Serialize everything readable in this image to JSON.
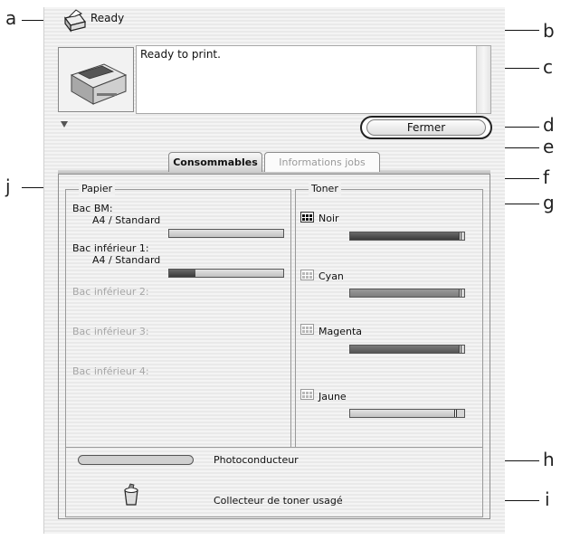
{
  "status": {
    "title": "Ready",
    "message": "Ready to print."
  },
  "buttons": {
    "close": "Fermer"
  },
  "tabs": [
    {
      "label": "Consommables",
      "active": true
    },
    {
      "label": "Informations jobs",
      "active": false
    }
  ],
  "paper": {
    "title": "Papier",
    "trays": [
      {
        "name": "Bac BM:",
        "size": "A4 / Standard",
        "level": 0.0,
        "enabled": true
      },
      {
        "name": "Bac inférieur 1:",
        "size": "A4 / Standard",
        "level": 0.23,
        "enabled": true
      },
      {
        "name": "Bac inférieur 2:",
        "size": "",
        "enabled": false
      },
      {
        "name": "Bac inférieur 3:",
        "size": "",
        "enabled": false
      },
      {
        "name": "Bac inférieur 4:",
        "size": "",
        "enabled": false
      }
    ]
  },
  "toner": {
    "title": "Toner",
    "cartridges": [
      {
        "name": "Noir",
        "level": 0.96,
        "icon": "toner-black-icon"
      },
      {
        "name": "Cyan",
        "level": 0.96,
        "icon": "toner-cyan-icon"
      },
      {
        "name": "Magenta",
        "level": 0.96,
        "icon": "toner-magenta-icon"
      },
      {
        "name": "Jaune",
        "level": 0.92,
        "icon": "toner-yellow-icon"
      }
    ]
  },
  "photoconductor": {
    "label": "Photoconducteur"
  },
  "waste_toner": {
    "label": "Collecteur de toner usagé"
  },
  "callouts": [
    "a",
    "b",
    "c",
    "d",
    "e",
    "f",
    "g",
    "h",
    "i",
    "j"
  ],
  "colors": {
    "bar_fill": "#4a4a4a",
    "bar_empty": "#d6d6d6",
    "disabled_text": "#a6a6a6"
  }
}
